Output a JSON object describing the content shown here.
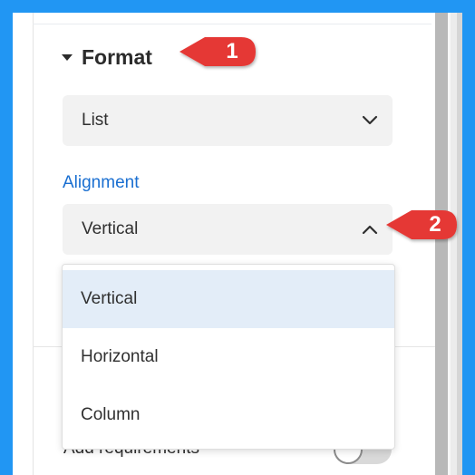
{
  "format_section": {
    "title": "Format",
    "caret_icon": "caret-down-icon"
  },
  "format_select": {
    "value": "List",
    "icon": "chevron-down-icon"
  },
  "alignment": {
    "label": "Alignment",
    "value": "Vertical",
    "icon": "chevron-up-icon",
    "options": [
      {
        "label": "Vertical",
        "selected": true
      },
      {
        "label": "Horizontal",
        "selected": false
      },
      {
        "label": "Column",
        "selected": false
      }
    ]
  },
  "requirements": {
    "label": "Add requirements",
    "enabled": false
  },
  "callouts": [
    {
      "number": "1"
    },
    {
      "number": "2"
    }
  ],
  "colors": {
    "frame_border": "#2196f3",
    "callout_red": "#e53935",
    "link_blue": "#1a6fd1",
    "selected_option": "#e3edf8"
  }
}
